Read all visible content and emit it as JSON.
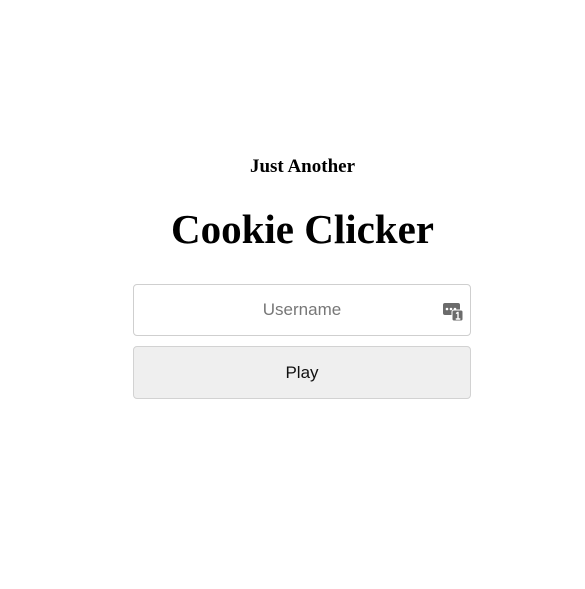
{
  "header": {
    "subtitle": "Just Another",
    "title": "Cookie Clicker"
  },
  "login": {
    "username": {
      "value": "",
      "placeholder": "Username",
      "icon": "password-manager-key-icon"
    },
    "play_label": "Play"
  },
  "colors": {
    "background": "#ffffff",
    "button_bg": "#efefef",
    "border": "#cfcfcf",
    "icon": "#6b6b6b"
  }
}
